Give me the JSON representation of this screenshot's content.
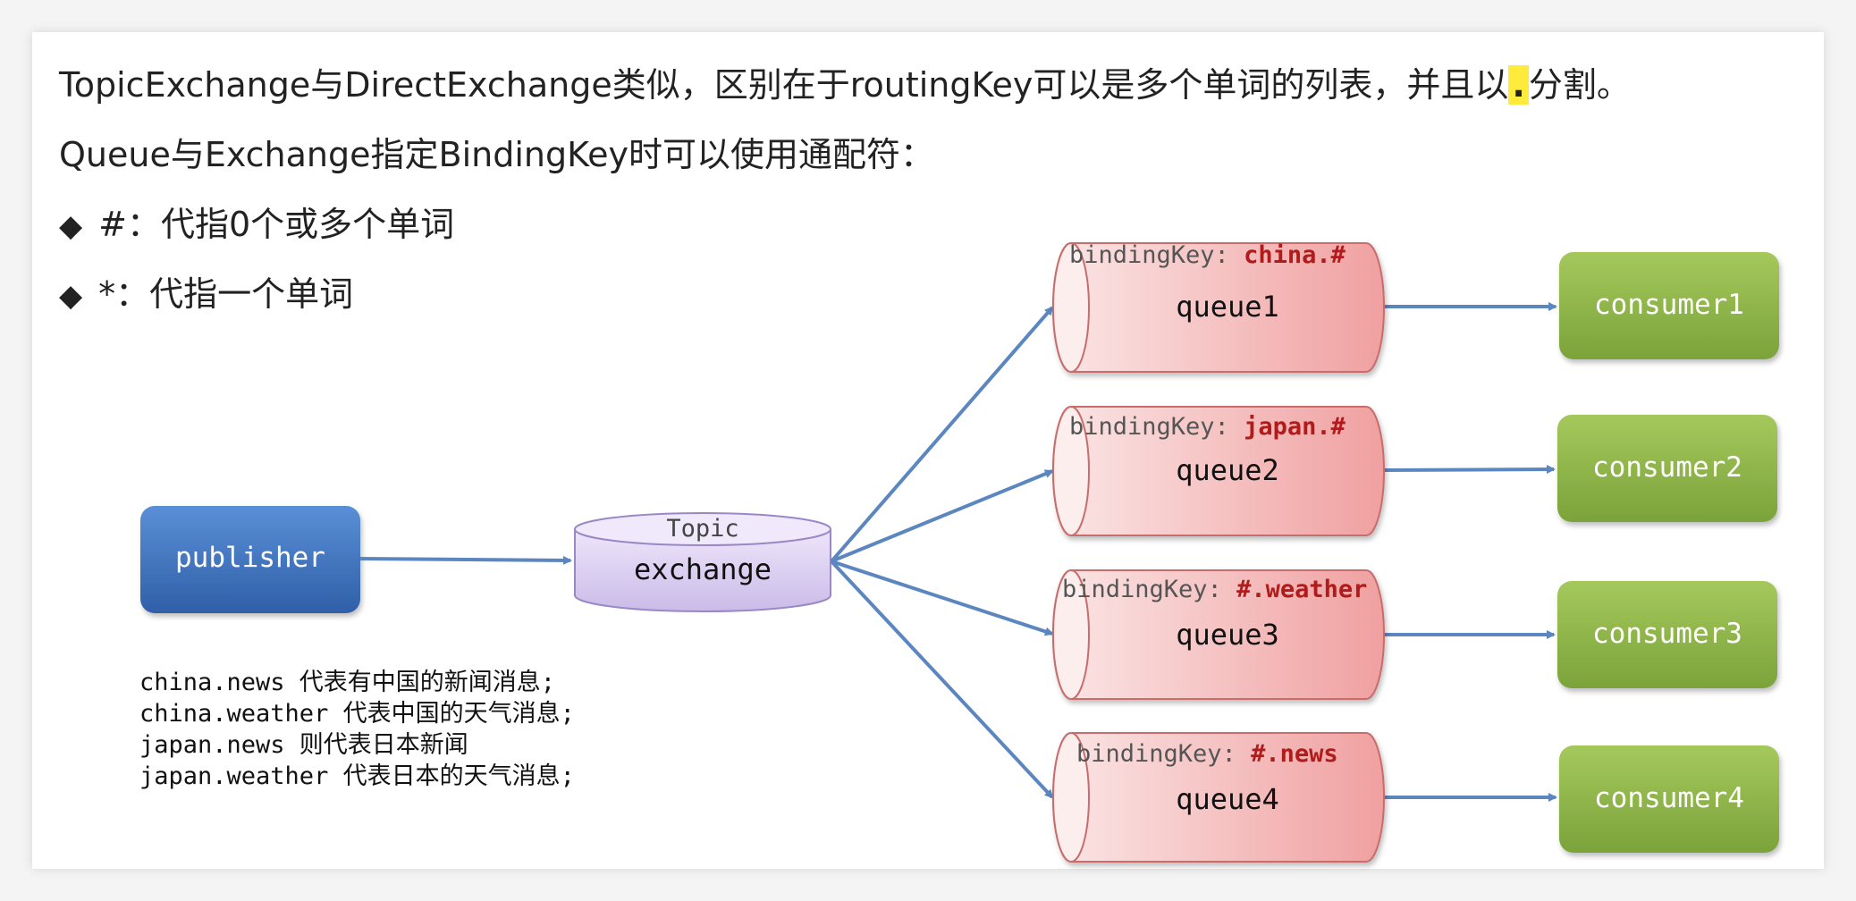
{
  "intro": {
    "line1_before": "TopicExchange与DirectExchange类似，区别在于routingKey可以是多个单词的列表，并且以",
    "line1_highlight": ".",
    "line1_after": "分割。",
    "line2": "Queue与Exchange指定BindingKey时可以使用通配符：",
    "bullets": [
      {
        "symbol": "◆",
        "text": "#：代指0个或多个单词"
      },
      {
        "symbol": "◆",
        "text": "*：代指一个单词"
      }
    ]
  },
  "diagram": {
    "publisher": "publisher",
    "exchange_type": "Topic",
    "exchange_name": "exchange",
    "binding_key_label": "bindingKey:",
    "queues": [
      {
        "name": "queue1",
        "binding": "china.#"
      },
      {
        "name": "queue2",
        "binding": "japan.#"
      },
      {
        "name": "queue3",
        "binding": "#.weather"
      },
      {
        "name": "queue4",
        "binding": "#.news"
      }
    ],
    "consumers": [
      "consumer1",
      "consumer2",
      "consumer3",
      "consumer4"
    ],
    "examples": [
      "china.news 代表有中国的新闻消息;",
      "china.weather 代表中国的天气消息;",
      "japan.news 则代表日本新闻",
      "japan.weather 代表日本的天气消息;"
    ]
  },
  "colors": {
    "publisher": "#3d6fb8",
    "exchange": "#d8cdf0",
    "queue": "#f2a0a0",
    "consumer": "#8fb848",
    "arrow": "#5b86c0",
    "binding_key": "#b01b1b",
    "highlight": "#ffeb3b"
  }
}
